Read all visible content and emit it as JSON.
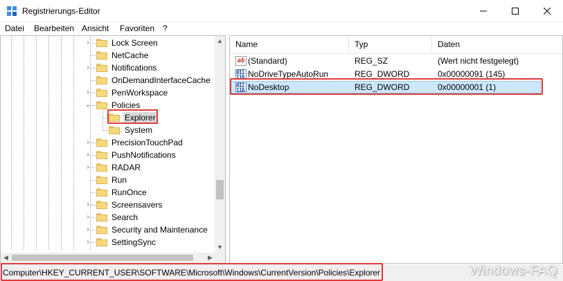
{
  "window": {
    "title": "Registrierungs-Editor"
  },
  "menu": [
    "Datei",
    "Bearbeiten",
    "Ansicht",
    "Favoriten",
    "?"
  ],
  "tree": {
    "items": [
      {
        "label": "Lock Screen",
        "expander": "right"
      },
      {
        "label": "NetCache",
        "expander": ""
      },
      {
        "label": "Notifications",
        "expander": "right"
      },
      {
        "label": "OnDemandInterfaceCache",
        "expander": ""
      },
      {
        "label": "PenWorkspace",
        "expander": "right"
      },
      {
        "label": "Policies",
        "expander": "down"
      },
      {
        "label": "Explorer",
        "expander": "",
        "selected": true
      },
      {
        "label": "System",
        "expander": ""
      },
      {
        "label": "PrecisionTouchPad",
        "expander": "right"
      },
      {
        "label": "PushNotifications",
        "expander": "right"
      },
      {
        "label": "RADAR",
        "expander": "right"
      },
      {
        "label": "Run",
        "expander": ""
      },
      {
        "label": "RunOnce",
        "expander": ""
      },
      {
        "label": "Screensavers",
        "expander": "right"
      },
      {
        "label": "Search",
        "expander": "right"
      },
      {
        "label": "Security and Maintenance",
        "expander": "right"
      },
      {
        "label": "SettingSync",
        "expander": "right"
      }
    ]
  },
  "list": {
    "columns": [
      "Name",
      "Typ",
      "Daten"
    ],
    "rows": [
      {
        "icon": "string-value-icon",
        "name": "(Standard)",
        "type": "REG_SZ",
        "data": "(Wert nicht festgelegt)"
      },
      {
        "icon": "binary-value-icon",
        "name": "NoDriveTypeAutoRun",
        "type": "REG_DWORD",
        "data": "0x00000091 (145)"
      },
      {
        "icon": "binary-value-icon",
        "name": "NoDesktop",
        "type": "REG_DWORD",
        "data": "0x00000001 (1)",
        "selected": true
      }
    ]
  },
  "status": {
    "path": "Computer\\HKEY_CURRENT_USER\\SOFTWARE\\Microsoft\\Windows\\CurrentVersion\\Policies\\Explorer"
  },
  "watermark": "Windows-FAQ",
  "colors": {
    "highlight_box": "#e03a3a",
    "selection": "#cce8ff",
    "folder": "#f7d97d"
  }
}
